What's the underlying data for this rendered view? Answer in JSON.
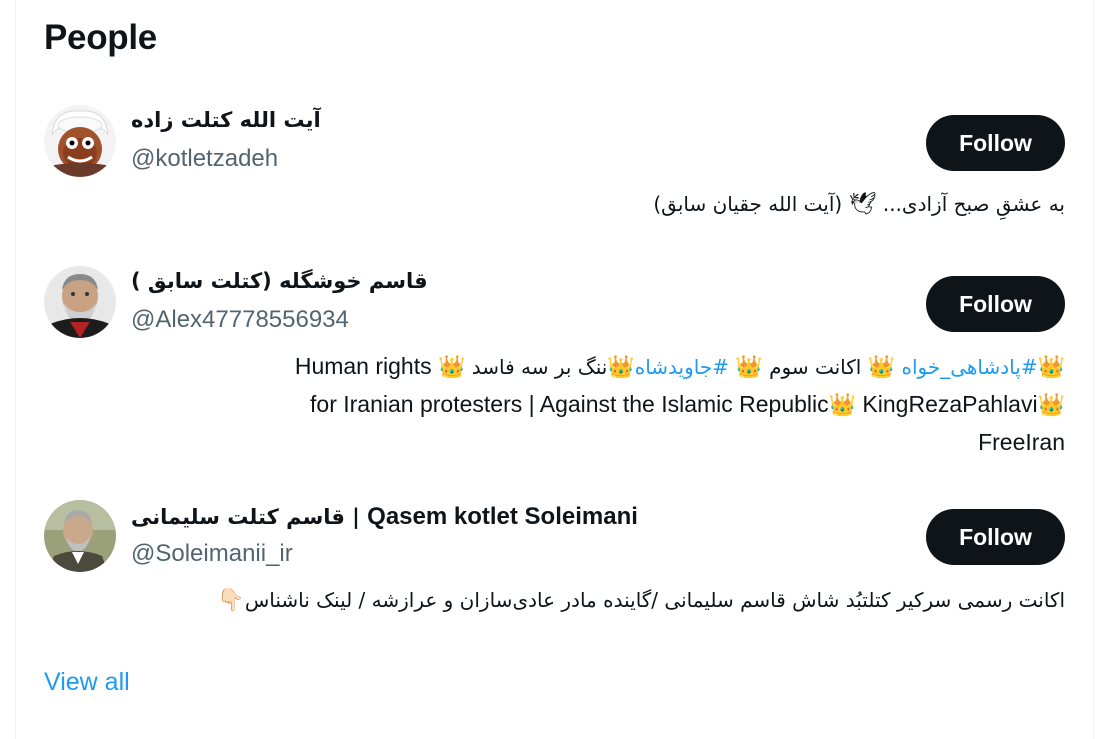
{
  "section": {
    "title": "People"
  },
  "people": [
    {
      "name": "آیت الله کتلت زاده",
      "handle": "@kotletzadeh",
      "follow_label": "Follow",
      "bio_part1": "به عشقِ صبح آزادی...",
      "bio_emoji": "🕊",
      "bio_part2": "(آیت الله جقیان سابق)"
    },
    {
      "name": "قاسم خوشگله (کتلت سابق )",
      "handle": "@Alex47778556934",
      "follow_label": "Follow",
      "crown": "👑",
      "bio_tag1": "#پادشاهی_خواه",
      "bio_tag2": "#جاویدشاه",
      "bio_text1": "اکانت سوم",
      "bio_text2": "ننگ بر سه فاسد",
      "bio_en1": "Human rights",
      "bio_en2": "for Iranian protesters | Against the Islamic Republic",
      "bio_en3": "KingRezaPahlavi",
      "bio_en4": "FreeIran"
    },
    {
      "name": "قاسم کتلت سلیمانی | Qasem kotlet Soleimani",
      "name_fa": "قاسم کتلت سلیمانی |",
      "name_en": "Qasem kotlet Soleimani",
      "handle": "@Soleimanii_ir",
      "follow_label": "Follow",
      "bio": "اکانت رسمی سرکیر کتلتبُد شاش قاسم سلیمانی /گاینده مادر عادی‌سازان و عرازشه / لینک ناشناس",
      "bio_emoji": "👇🏻"
    }
  ],
  "footer": {
    "view_all": "View all"
  },
  "colors": {
    "accent": "#1d9bf0",
    "follow_bg": "#0f1419",
    "secondary_text": "#536471"
  },
  "icons": {
    "avatar1": "cleric-cartoon-avatar",
    "avatar2": "bearded-man-avatar",
    "avatar3": "general-photo-avatar"
  }
}
